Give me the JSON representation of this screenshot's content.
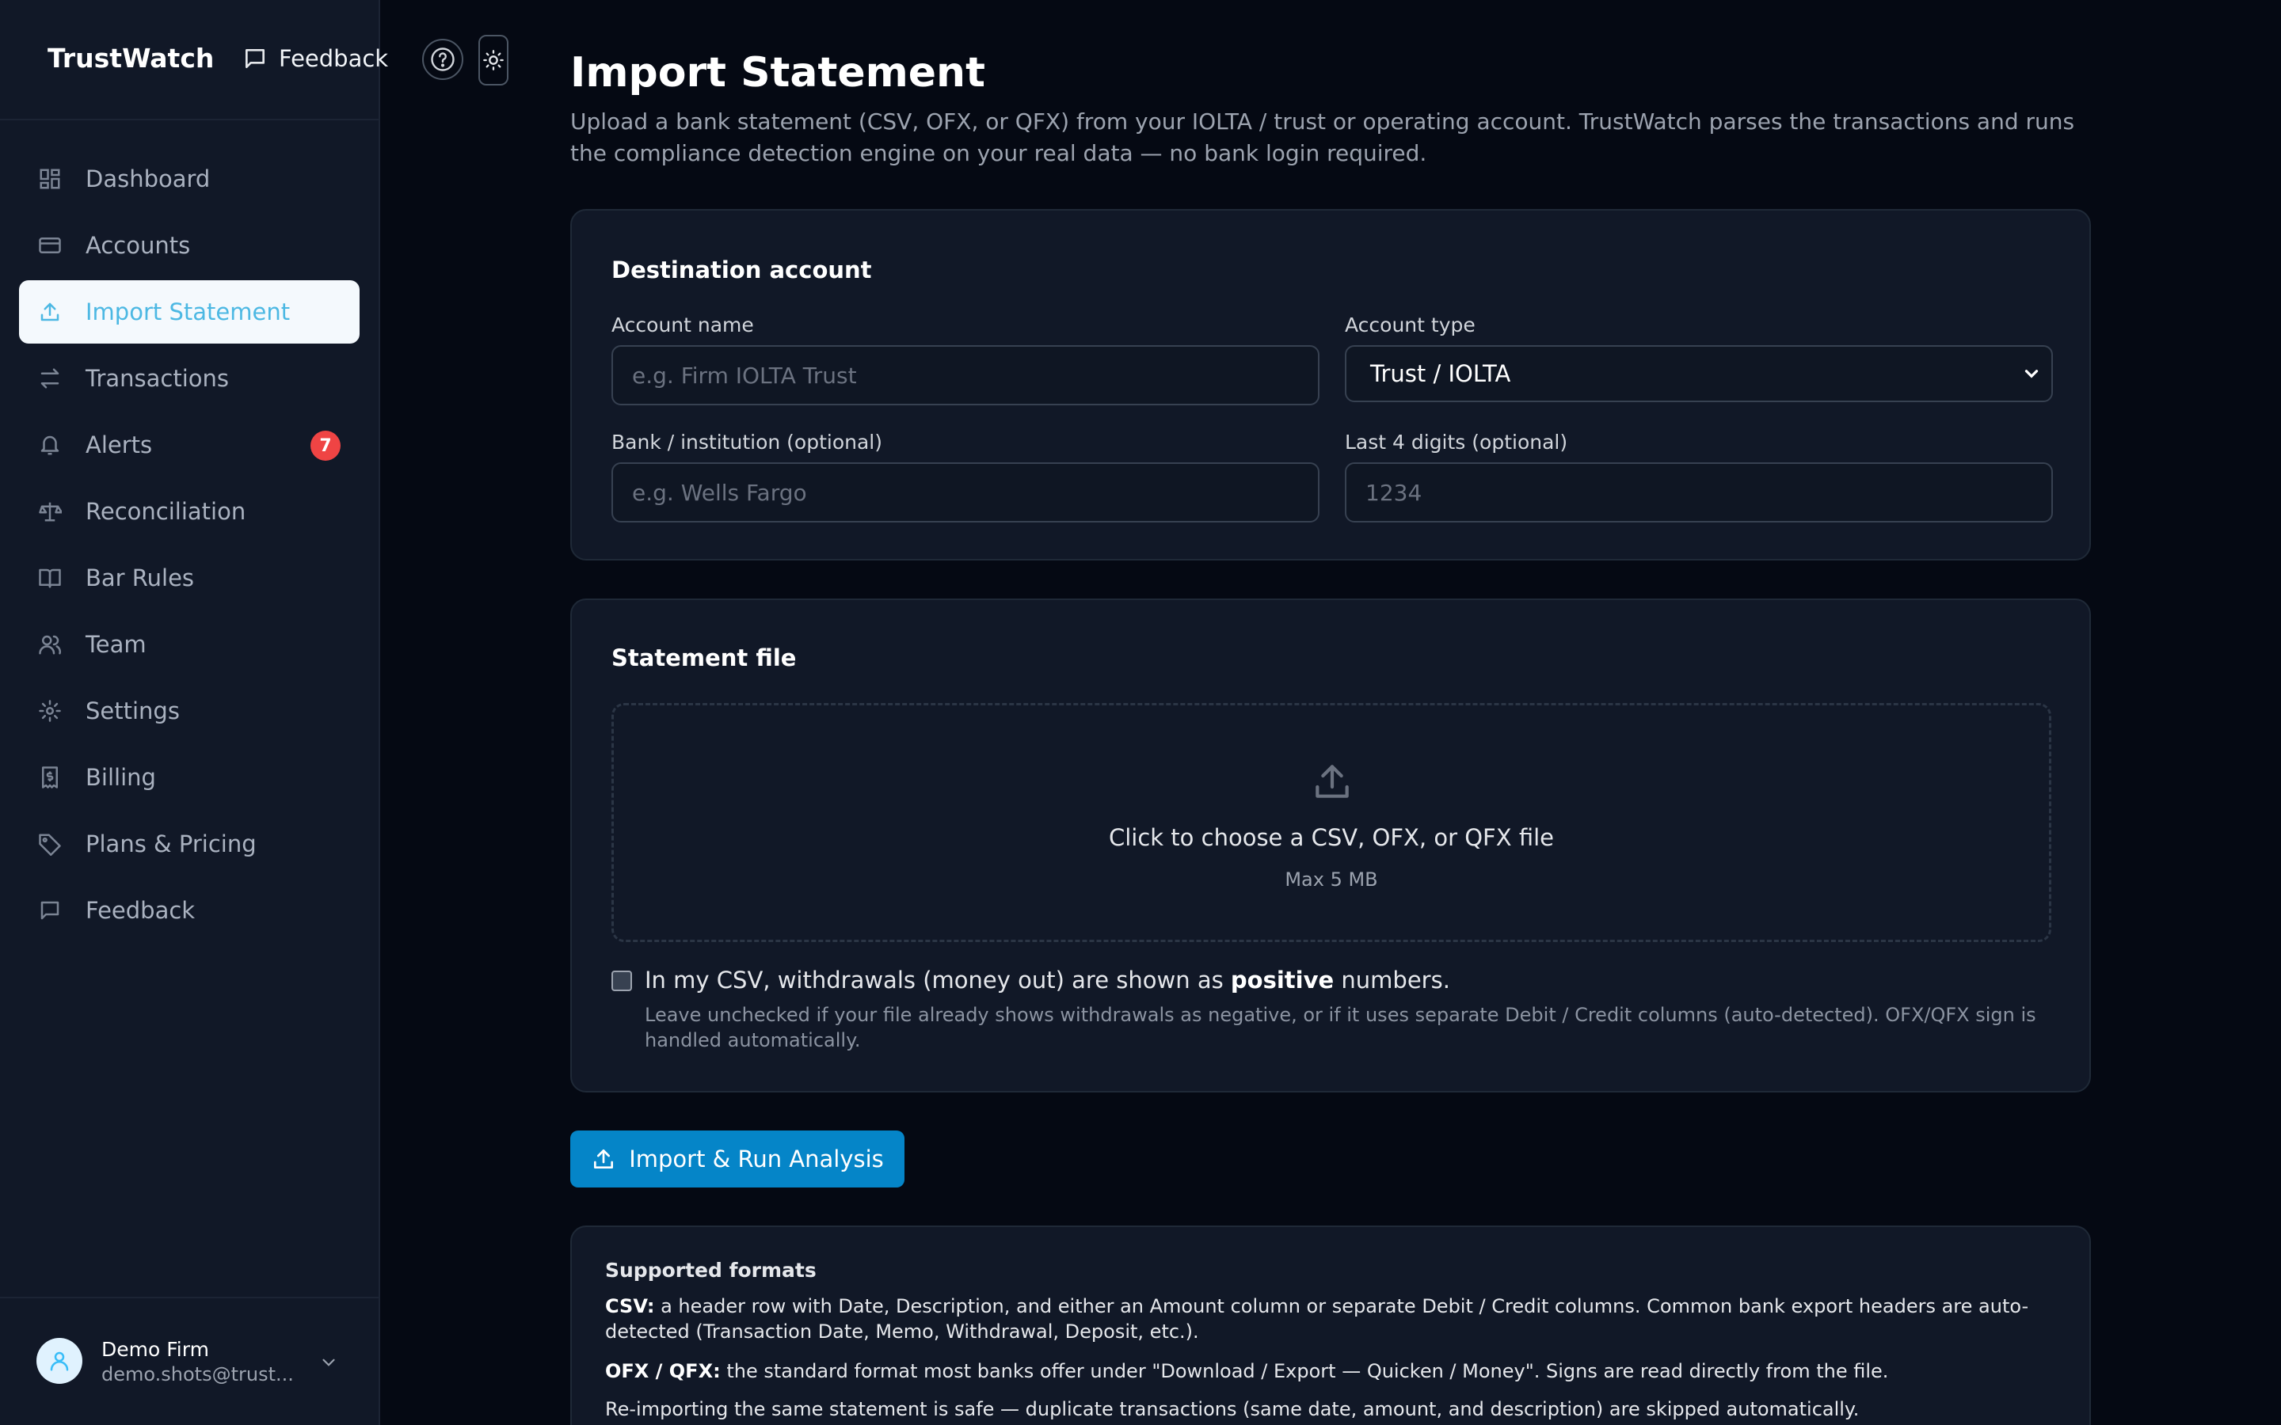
{
  "app": {
    "brand": "TrustWatch",
    "feedback_label": "Feedback"
  },
  "sidebar": {
    "items": [
      {
        "label": "Dashboard",
        "icon": "grid-icon"
      },
      {
        "label": "Accounts",
        "icon": "card-icon"
      },
      {
        "label": "Import Statement",
        "icon": "upload-icon",
        "active": true
      },
      {
        "label": "Transactions",
        "icon": "arrows-icon"
      },
      {
        "label": "Alerts",
        "icon": "bell-icon",
        "badge": "7"
      },
      {
        "label": "Reconciliation",
        "icon": "scale-icon"
      },
      {
        "label": "Bar Rules",
        "icon": "book-icon"
      },
      {
        "label": "Team",
        "icon": "users-icon"
      },
      {
        "label": "Settings",
        "icon": "gear-icon"
      },
      {
        "label": "Billing",
        "icon": "receipt-icon"
      },
      {
        "label": "Plans & Pricing",
        "icon": "tag-icon"
      },
      {
        "label": "Feedback",
        "icon": "message-icon"
      }
    ],
    "user": {
      "name": "Demo Firm",
      "email": "demo.shots@trust..."
    }
  },
  "page": {
    "title": "Import Statement",
    "description": "Upload a bank statement (CSV, OFX, or QFX) from your IOLTA / trust or operating account. TrustWatch parses the transactions and runs the compliance detection engine on your real data — no bank login required."
  },
  "destination": {
    "title": "Destination account",
    "account_name_label": "Account name",
    "account_name_placeholder": "e.g. Firm IOLTA Trust",
    "account_type_label": "Account type",
    "account_type_value": "Trust / IOLTA",
    "bank_label": "Bank / institution (optional)",
    "bank_placeholder": "e.g. Wells Fargo",
    "last4_label": "Last 4 digits (optional)",
    "last4_placeholder": "1234"
  },
  "statement": {
    "title": "Statement file",
    "dropzone_text": "Click to choose a CSV, OFX, or QFX file",
    "dropzone_sub": "Max 5 MB",
    "checkbox_prefix": "In my CSV, withdrawals (money out) are shown as",
    "checkbox_bold": "positive",
    "checkbox_suffix": "numbers.",
    "checkbox_help": "Leave unchecked if your file already shows withdrawals as negative, or if it uses separate Debit / Credit columns (auto-detected). OFX/QFX sign is handled automatically."
  },
  "actions": {
    "import_label": "Import & Run Analysis"
  },
  "formats": {
    "title": "Supported formats",
    "csv_label": "CSV:",
    "csv_text": "a header row with Date, Description, and either an Amount column or separate Debit / Credit columns. Common bank export headers are auto-detected (Transaction Date, Memo, Withdrawal, Deposit, etc.).",
    "ofx_label": "OFX / QFX:",
    "ofx_text": "the standard format most banks offer under \"Download / Export — Quicken / Money\". Signs are read directly from the file.",
    "reimport_text": "Re-importing the same statement is safe — duplicate transactions (same date, amount, and description) are skipped automatically."
  },
  "colors": {
    "background": "#050913",
    "sidebar": "#111827",
    "accent": "#0585c8",
    "active_text": "#4cb8e3",
    "badge": "#ef4444"
  }
}
